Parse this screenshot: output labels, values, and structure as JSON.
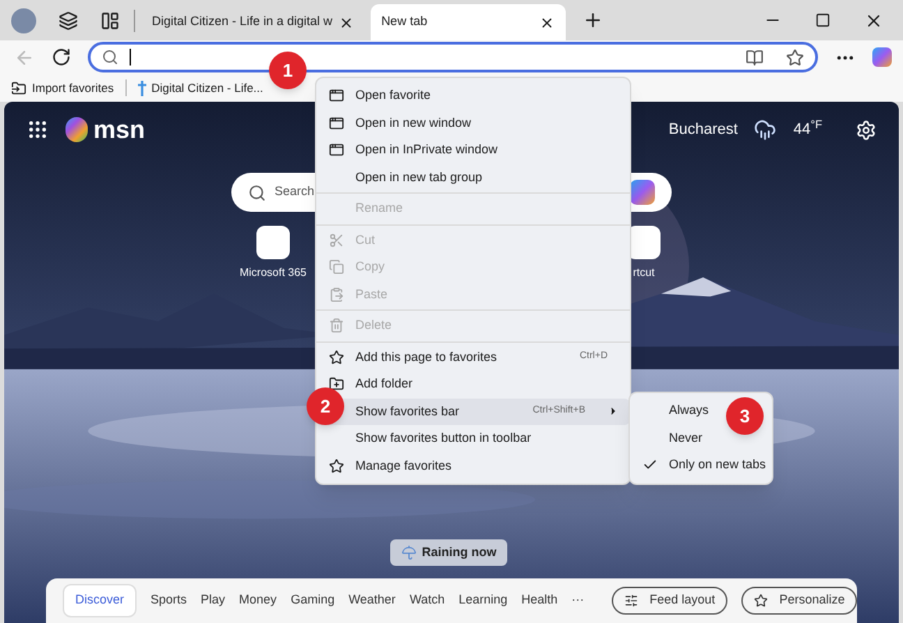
{
  "tabs": [
    {
      "title": "Digital Citizen - Life in a digital w",
      "selected": false
    },
    {
      "title": "New tab",
      "selected": true
    }
  ],
  "favorites_bar": [
    "Import favorites",
    "Digital Citizen - Life..."
  ],
  "msn": {
    "logo": "msn",
    "location": "Bucharest",
    "temperature": "44$^{°F}$",
    "search_placeholder": "Search",
    "shortcuts": [
      "Microsoft 365",
      "rtcut"
    ],
    "weather_button": "Raining now"
  },
  "feed_tabs": [
    {
      "label": "Discover",
      "selected": true
    },
    {
      "label": "Sports",
      "selected": false
    },
    {
      "label": "Play",
      "selected": false
    },
    {
      "label": "Money",
      "selected": false
    },
    {
      "label": "Gaming",
      "selected": false
    },
    {
      "label": "Weather",
      "selected": false
    },
    {
      "label": "Watch",
      "selected": false
    },
    {
      "label": "Learning",
      "selected": false
    },
    {
      "label": "Health",
      "selected": false
    }
  ],
  "feed_more": "···",
  "feed_buttons": [
    "Feed layout",
    "Personalize"
  ],
  "context_menu": [
    {
      "label": "Open favorite",
      "disabled": false,
      "separator_before": false
    },
    {
      "label": "Open in new window",
      "disabled": false,
      "separator_before": false
    },
    {
      "label": "Open in InPrivate window",
      "disabled": false,
      "separator_before": false
    },
    {
      "label": "Open in new tab group",
      "disabled": false,
      "separator_before": false
    },
    {
      "label": "Rename",
      "disabled": true,
      "separator_before": true
    },
    {
      "label": "Cut",
      "disabled": true,
      "separator_before": true
    },
    {
      "label": "Copy",
      "disabled": true,
      "separator_before": false
    },
    {
      "label": "Paste",
      "disabled": true,
      "separator_before": false
    },
    {
      "label": "Delete",
      "disabled": true,
      "separator_before": true
    },
    {
      "label": "Add this page to favorites",
      "disabled": false,
      "separator_before": true,
      "shortcut": "Ctrl+D"
    },
    {
      "label": "Add folder",
      "disabled": false,
      "separator_before": false
    },
    {
      "label": "Show favorites bar",
      "disabled": false,
      "separator_before": false,
      "shortcut": "Ctrl+Shift+B",
      "submenu": true,
      "selected": true
    },
    {
      "label": "Show favorites button in toolbar",
      "disabled": false,
      "separator_before": false
    },
    {
      "label": "Manage favorites",
      "disabled": false,
      "separator_before": false
    }
  ],
  "submenu": [
    {
      "label": "Always",
      "checked": false
    },
    {
      "label": "Never",
      "checked": false
    },
    {
      "label": "Only on new tabs",
      "checked": true
    }
  ],
  "annotations": [
    "1",
    "2",
    "3"
  ]
}
